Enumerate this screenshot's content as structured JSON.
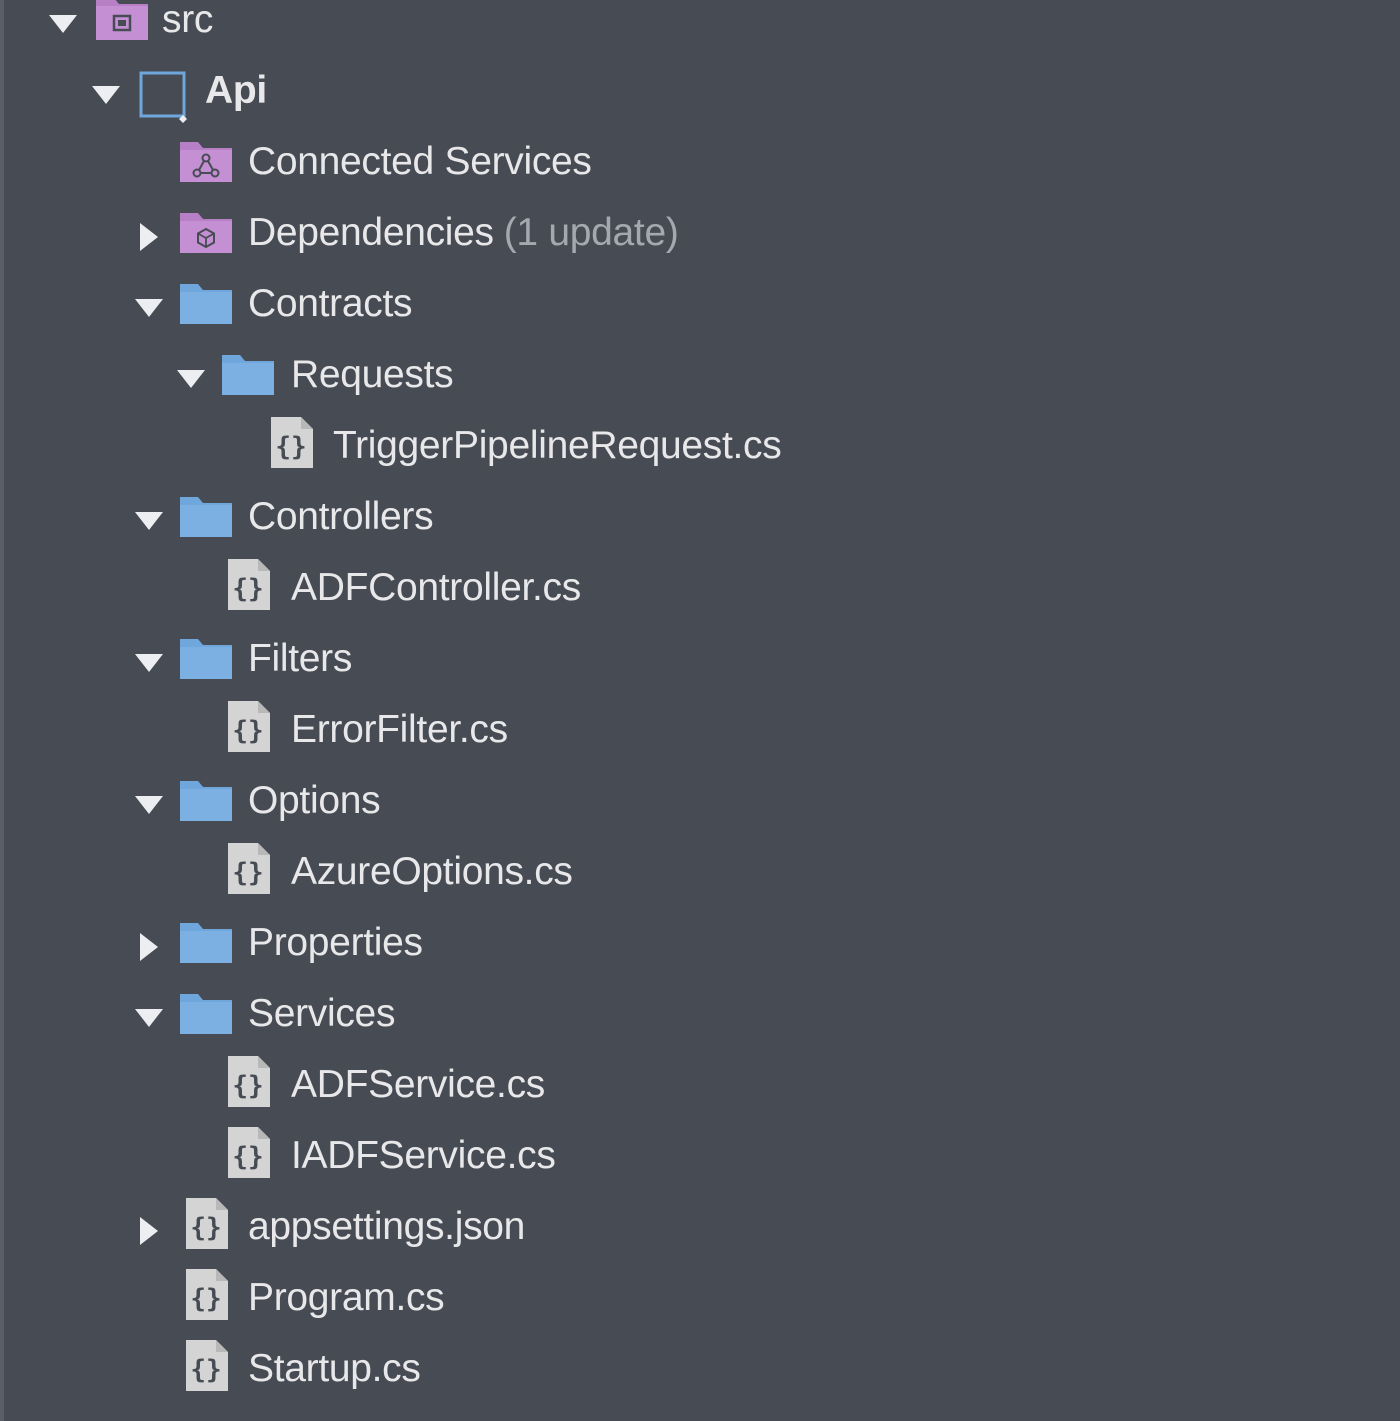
{
  "tree": {
    "src": {
      "label": "src",
      "icon": "solution-folder-icon",
      "expanded": true
    },
    "api": {
      "label": "Api",
      "icon": "project-icon",
      "expanded": true
    },
    "connected_services": {
      "label": "Connected Services",
      "icon": "connected-services-icon"
    },
    "dependencies": {
      "label": "Dependencies",
      "hint": "(1 update)",
      "icon": "dependencies-icon",
      "expanded": false
    },
    "contracts": {
      "label": "Contracts",
      "icon": "folder-icon",
      "expanded": true
    },
    "requests": {
      "label": "Requests",
      "icon": "folder-icon",
      "expanded": true
    },
    "trigger_pipeline_request": {
      "label": "TriggerPipelineRequest.cs",
      "icon": "csharp-file-icon"
    },
    "controllers": {
      "label": "Controllers",
      "icon": "folder-icon",
      "expanded": true
    },
    "adf_controller": {
      "label": "ADFController.cs",
      "icon": "csharp-file-icon"
    },
    "filters": {
      "label": "Filters",
      "icon": "folder-icon",
      "expanded": true
    },
    "error_filter": {
      "label": "ErrorFilter.cs",
      "icon": "csharp-file-icon"
    },
    "options": {
      "label": "Options",
      "icon": "folder-icon",
      "expanded": true
    },
    "azure_options": {
      "label": "AzureOptions.cs",
      "icon": "csharp-file-icon"
    },
    "properties": {
      "label": "Properties",
      "icon": "folder-icon",
      "expanded": false
    },
    "services": {
      "label": "Services",
      "icon": "folder-icon",
      "expanded": true
    },
    "adf_service": {
      "label": "ADFService.cs",
      "icon": "csharp-file-icon"
    },
    "iadf_service": {
      "label": "IADFService.cs",
      "icon": "csharp-file-icon"
    },
    "appsettings": {
      "label": "appsettings.json",
      "icon": "json-file-icon",
      "expanded": false
    },
    "program": {
      "label": "Program.cs",
      "icon": "csharp-file-icon"
    },
    "startup": {
      "label": "Startup.cs",
      "icon": "csharp-file-icon"
    }
  },
  "colors": {
    "background": "#474b53",
    "text": "#e8e8ea",
    "hint_text": "#a5a8ae",
    "folder_blue": "#6fa6db",
    "special_folder_purple": "#c58fd4",
    "project_outline_blue": "#6fa6db",
    "file_icon_gray": "#d4d4d4"
  }
}
